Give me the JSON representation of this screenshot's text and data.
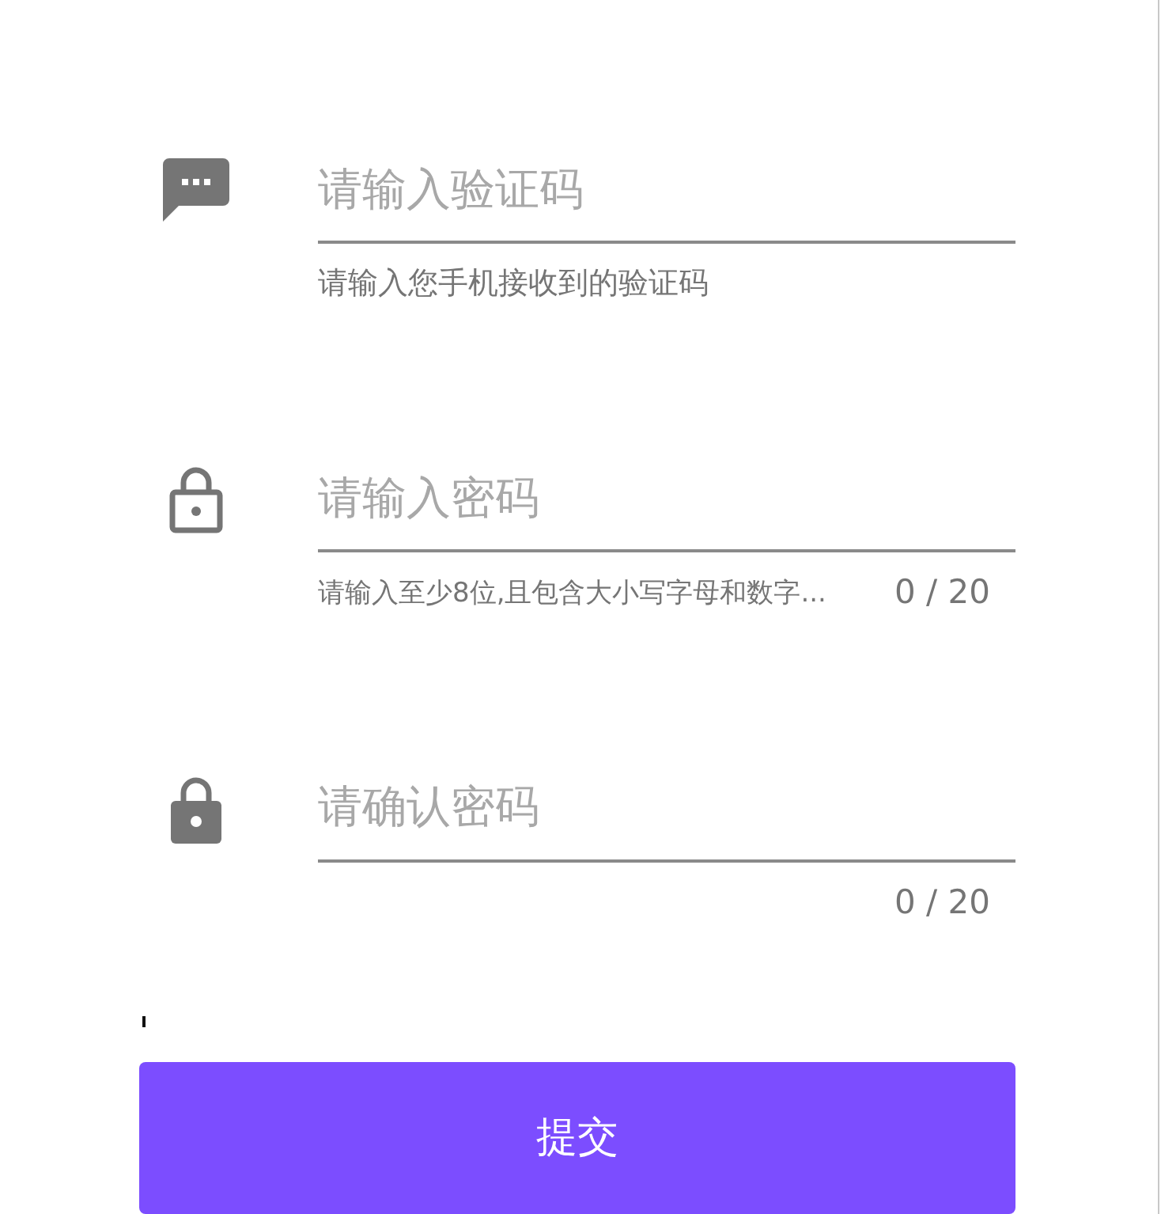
{
  "fields": [
    {
      "kind": "message",
      "placeholder": "请输入验证码",
      "helper": "请输入您手机接收到的验证码"
    },
    {
      "kind": "lock",
      "placeholder": "请输入密码",
      "helper": "请输入至少8位,且包含大小写字母和数字...",
      "counter": "0 / 20"
    },
    {
      "kind": "confirm",
      "placeholder": "请确认密码",
      "counter": "0 / 20"
    }
  ],
  "submit_button": "提交"
}
